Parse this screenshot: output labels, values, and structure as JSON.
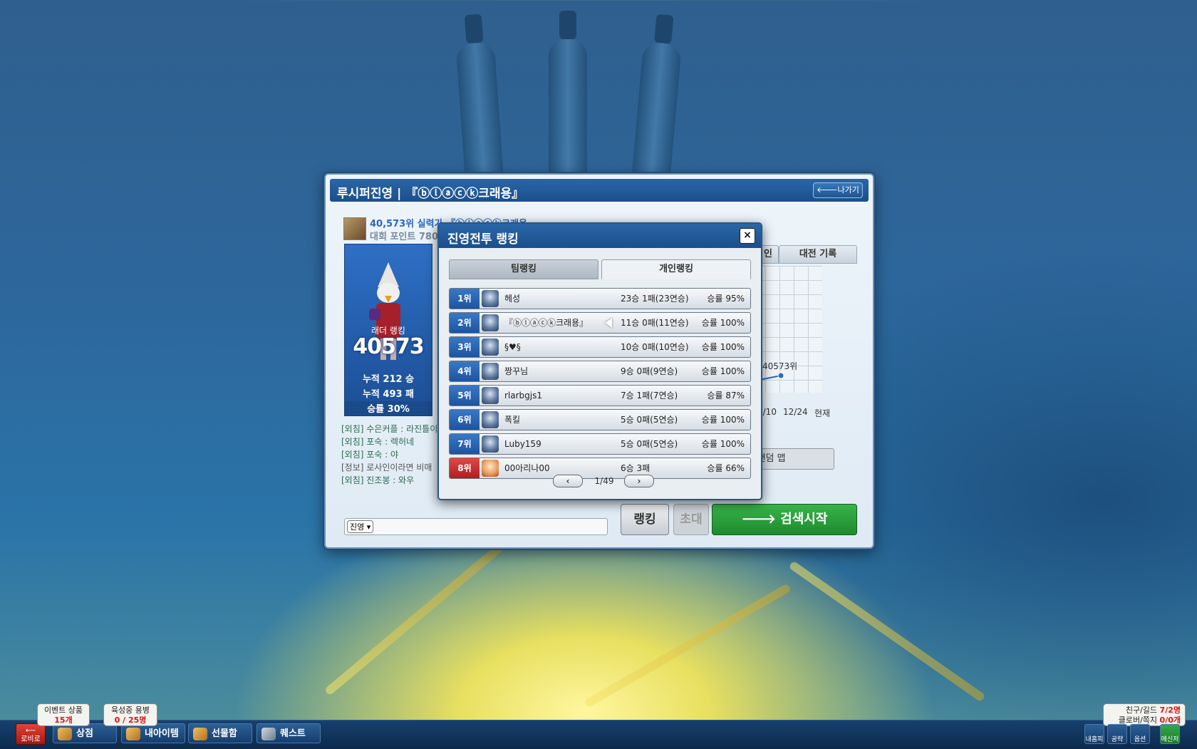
{
  "main": {
    "title": "루시퍼진영 | 『ⓑⓛⓐⓒⓚ크래용』",
    "back_label": "🡐나가기",
    "rank_line": "40,573위 실력가 『ⓑⓛⓐⓒⓚ크래용",
    "points_line": "대회 포인트 780",
    "ladder_label": "래더 랭킹",
    "ladder_rank": "40573",
    "wins": "누적 212 승",
    "losses": "누적 493 패",
    "winrate": "승률 30%",
    "tab_partial": "인",
    "tab_record": "대전 기록",
    "graph_point_label": "40573위",
    "graph_x_labels": [
      "2/10",
      "12/24",
      "현재"
    ],
    "map_label": "| 랜덤 맵",
    "chat_lines": [
      "[외침] 수은커플 : 라진틀이",
      "[외침] 포숙 : 렉허네",
      "[외침] 포숙 : 야",
      "[정보] 로사인이라면 비매",
      "[외침] 진조봉 : 와우"
    ],
    "chat_channel": "진영",
    "btn_rank": "랭킹",
    "btn_invite": "초대",
    "btn_search": "🡒 검색시작"
  },
  "ranking_popup": {
    "title": "진영전투 랭킹",
    "close_icon": "×",
    "tab_team": "팀랭킹",
    "tab_personal": "개인랭킹",
    "rows": [
      {
        "pos": "1위",
        "name": "헤성",
        "record": "23승 1패(23연승)",
        "winrate": "승률 95%"
      },
      {
        "pos": "2위",
        "name": "『ⓑⓛⓐⓒⓚ크래용』",
        "record": "11승 0패(11연승)",
        "winrate": "승률 100%"
      },
      {
        "pos": "3위",
        "name": "§♥§",
        "record": "10승 0패(10연승)",
        "winrate": "승률 100%"
      },
      {
        "pos": "4위",
        "name": "짱꾸님",
        "record": "9승 0패(9연승)",
        "winrate": "승률 100%"
      },
      {
        "pos": "5위",
        "name": "rlarbgjs1",
        "record": "7승 1패(7연승)",
        "winrate": "승률 87%"
      },
      {
        "pos": "6위",
        "name": "폭킬",
        "record": "5승 0패(5연승)",
        "winrate": "승률 100%"
      },
      {
        "pos": "7위",
        "name": "Luby159",
        "record": "5승 0패(5연승)",
        "winrate": "승률 100%"
      },
      {
        "pos": "8위",
        "name": "00아리나00",
        "record": "6승 3패",
        "winrate": "승률 66%"
      }
    ],
    "page": "1/49",
    "prev_icon": "‹",
    "next_icon": "›"
  },
  "bottom": {
    "lobby": "로비로",
    "shop": "상점",
    "my_items": "내아이템",
    "gift_box": "선물함",
    "quest": "퀘스트",
    "event_label": "이벤트 상품",
    "event_count": "15개",
    "mercenary_label": "육성중 용병",
    "mercenary_count": "0 / 25명",
    "friends_label": "친구/길드",
    "friends_count": "7/2명",
    "mail_label": "클로버/쪽지",
    "mail_count": "0/0개",
    "sys_buttons": [
      "내홈피",
      "공략",
      "옵션",
      "메신저"
    ]
  }
}
